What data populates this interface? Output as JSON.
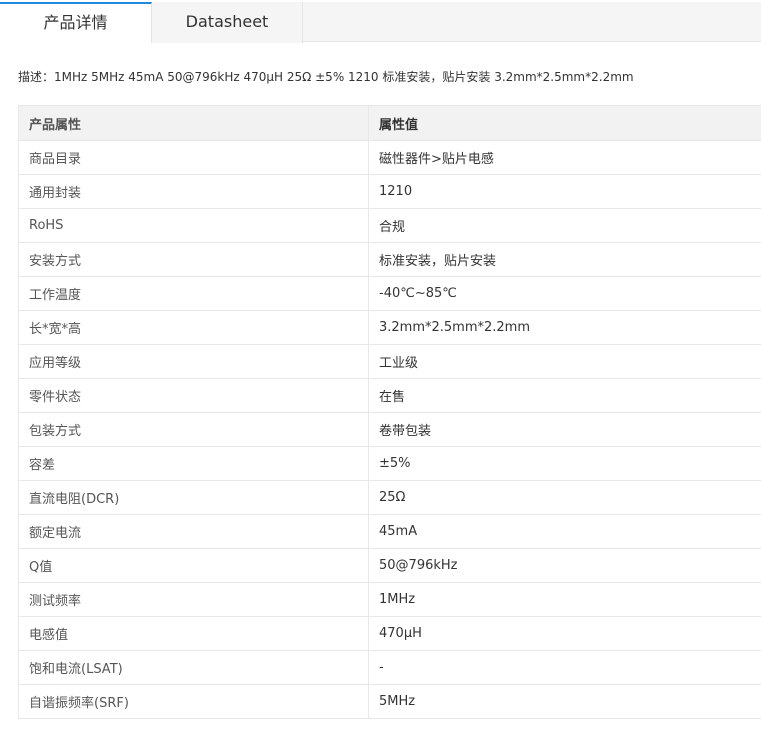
{
  "tabs": [
    {
      "label": "产品详情",
      "active": true
    },
    {
      "label": "Datasheet",
      "active": false
    }
  ],
  "description": "描述：1MHz 5MHz 45mA 50@796kHz 470µH 25Ω ±5% 1210 标准安装，贴片安装 3.2mm*2.5mm*2.2mm",
  "table": {
    "headers": [
      "产品属性",
      "属性值"
    ],
    "rows": [
      [
        "商品目录",
        "磁性器件>贴片电感"
      ],
      [
        "通用封装",
        "1210"
      ],
      [
        "RoHS",
        "合规"
      ],
      [
        "安装方式",
        "标准安装，贴片安装"
      ],
      [
        "工作温度",
        "-40℃~85℃"
      ],
      [
        "长*宽*高",
        "3.2mm*2.5mm*2.2mm"
      ],
      [
        "应用等级",
        "工业级"
      ],
      [
        "零件状态",
        "在售"
      ],
      [
        "包装方式",
        "卷带包装"
      ],
      [
        "容差",
        "±5%"
      ],
      [
        "直流电阻(DCR)",
        "25Ω"
      ],
      [
        "额定电流",
        "45mA"
      ],
      [
        "Q值",
        "50@796kHz"
      ],
      [
        "测试频率",
        "1MHz"
      ],
      [
        "电感值",
        "470µH"
      ],
      [
        "饱和电流(LSAT)",
        "-"
      ],
      [
        "自谐振频率(SRF)",
        "5MHz"
      ]
    ]
  },
  "colors": {
    "accent": "#1e8be0",
    "header_bg": "#f2f2f2",
    "border": "#e8e8e8"
  }
}
